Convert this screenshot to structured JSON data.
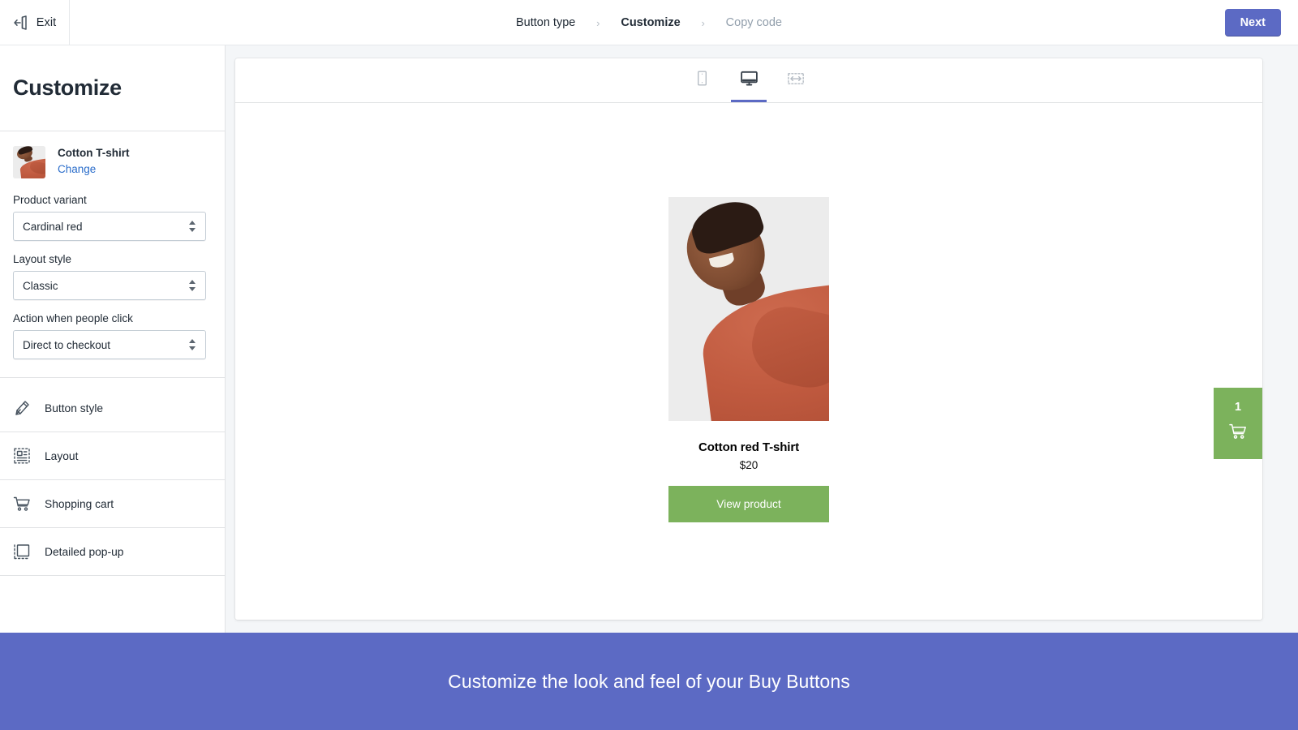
{
  "topbar": {
    "exit_label": "Exit",
    "exit_icon": "exit-door-arrow-icon",
    "next_label": "Next",
    "next_color": "#5c6ac4"
  },
  "breadcrumb": {
    "separator": "›",
    "steps": [
      {
        "label": "Button type",
        "state": "done"
      },
      {
        "label": "Customize",
        "state": "current"
      },
      {
        "label": "Copy code",
        "state": "upcoming"
      }
    ]
  },
  "sidebar": {
    "title": "Customize",
    "product": {
      "name": "Cotton T-shirt",
      "change_label": "Change",
      "change_color": "#2c6ecb",
      "thumbnail_alt": "cotton-t-shirt-thumbnail"
    },
    "fields": [
      {
        "label": "Product variant",
        "value": "Cardinal red",
        "name": "product-variant-select"
      },
      {
        "label": "Layout style",
        "value": "Classic",
        "name": "layout-style-select"
      },
      {
        "label": "Action when people click",
        "value": "Direct to checkout",
        "name": "action-when-clicked-select"
      }
    ],
    "nav_items": [
      {
        "label": "Button style",
        "icon": "paint-brush-icon"
      },
      {
        "label": "Layout",
        "icon": "layout-grid-icon"
      },
      {
        "label": "Shopping cart",
        "icon": "shopping-cart-icon"
      },
      {
        "label": "Detailed pop-up",
        "icon": "popup-window-icon"
      }
    ]
  },
  "preview": {
    "devices": [
      {
        "name": "mobile",
        "icon": "mobile-phone-icon",
        "active": false
      },
      {
        "name": "desktop",
        "icon": "desktop-monitor-icon",
        "active": true
      },
      {
        "name": "full-width",
        "icon": "full-width-arrows-icon",
        "active": false
      }
    ],
    "active_device_underline_color": "#5c6ac4",
    "buy_button": {
      "product_title": "Cotton red T-shirt",
      "price": "$20",
      "cta_label": "View product",
      "cta_color": "#7cb25c",
      "image_alt": "woman-wearing-red-cotton-tshirt"
    },
    "cart": {
      "count": "1",
      "icon": "shopping-cart-icon",
      "color": "#7cb25c"
    }
  },
  "banner": {
    "text": "Customize the look and feel of your Buy Buttons",
    "background": "#5c6ac4"
  }
}
